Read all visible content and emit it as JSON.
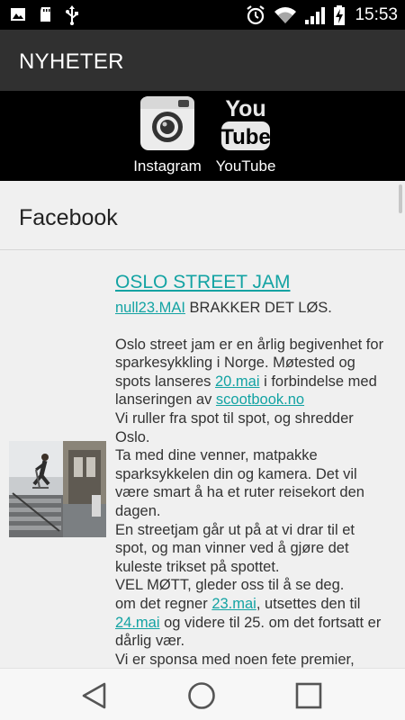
{
  "status_bar": {
    "time": "15:53",
    "icons": [
      "image-icon",
      "sd-card-icon",
      "usb-icon",
      "alarm-icon",
      "wifi-icon",
      "signal-icon",
      "battery-charging-icon"
    ]
  },
  "app_bar": {
    "title": "NYHETER"
  },
  "social": {
    "instagram_label": "Instagram",
    "youtube_label": "YouTube",
    "youtube_logo_top": "You",
    "youtube_logo_bottom": "Tube"
  },
  "facebook": {
    "title": "Facebook"
  },
  "post": {
    "headline": "OSLO STREET JAM",
    "date_link": "null23.MAI",
    "subtitle_rest": " BRAKKER DET LØS.",
    "p1_a": "Oslo street jam er en årlig begivenhet for sparkesykkling i Norge. Møtested og spots lanseres ",
    "p1_link1": "20.mai",
    "p1_b": " i forbindelse med lanseringen av ",
    "p1_link2": "scootbook.no",
    "line2": "Vi ruller fra spot til spot, og shredder Oslo.",
    "line3": "Ta med dine venner, matpakke sparksykkelen din og kamera. Det vil være smart å ha et ruter reisekort den dagen.",
    "line4": "En streetjam går ut på at vi drar til et spot, og man vinner ved å gjøre det kuleste trikset på spottet.",
    "line5": "VEL MØTT, gleder oss til å se deg.",
    "line6_a": "om det regner ",
    "line6_link1": "23.mai",
    "line6_b": ", utsettes den til ",
    "line6_link2": "24.mai",
    "line6_c": " og videre til 25. om det fortsatt er dårlig vær.",
    "line7": "Vi er sponsa med noen fete premier,"
  },
  "colors": {
    "link": "#13a3a3",
    "app_bar": "#303030",
    "status_bar": "#000000"
  }
}
